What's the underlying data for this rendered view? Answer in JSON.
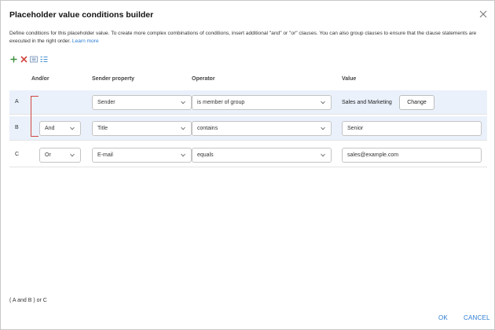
{
  "dialog": {
    "title": "Placeholder value conditions builder",
    "description": "Define conditions for this placeholder value. To create more complex combinations of conditions, insert additional \"and\" or \"or\" clauses. You can also group clauses to ensure that the clause statements are executed in the right order.",
    "learn_more": "Learn more",
    "toolbar": {
      "add_icon": "plus-icon",
      "delete_icon": "delete-x-icon",
      "group_icon": "group-icon",
      "ungroup_icon": "ungroup-icon"
    }
  },
  "columns": {
    "andor": "And/or",
    "property": "Sender property",
    "operator": "Operator",
    "value": "Value"
  },
  "rows": [
    {
      "letter": "A",
      "andor": "",
      "property": "Sender",
      "operator": "is member of group",
      "value": "Sales and Marketing",
      "value_button": "Change"
    },
    {
      "letter": "B",
      "andor": "And",
      "property": "Title",
      "operator": "contains",
      "value": "Senior"
    },
    {
      "letter": "C",
      "andor": "Or",
      "property": "E-mail",
      "operator": "equals",
      "value": "sales@example.com"
    }
  ],
  "summary": "( A and B ) or C",
  "footer": {
    "ok": "OK",
    "cancel": "CANCEL"
  },
  "colors": {
    "accent": "#2b7cd3",
    "delete": "#d0473f",
    "selected_row": "#eaf1fb"
  }
}
